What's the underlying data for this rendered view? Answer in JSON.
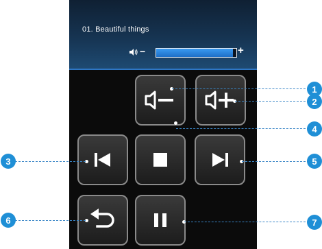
{
  "player": {
    "track_title": "01. Beautiful things",
    "volume": {
      "minus_label": "−",
      "plus_label": "+",
      "level": 0.96
    }
  },
  "buttons": [
    {
      "name": "volume-down-button",
      "icon": "speaker-minus-icon"
    },
    {
      "name": "volume-up-button",
      "icon": "speaker-plus-icon"
    },
    {
      "name": "previous-track-button",
      "icon": "skip-previous-icon"
    },
    {
      "name": "stop-button",
      "icon": "stop-icon"
    },
    {
      "name": "next-track-button",
      "icon": "skip-next-icon"
    },
    {
      "name": "back-button",
      "icon": "return-arrow-icon"
    },
    {
      "name": "pause-button",
      "icon": "pause-icon"
    }
  ],
  "callouts": [
    "1",
    "2",
    "3",
    "4",
    "5",
    "6",
    "7"
  ],
  "colors": {
    "accent": "#1f8fd6",
    "volume_fill": "#2b86e0",
    "screen_background": "#0b0b0b"
  }
}
